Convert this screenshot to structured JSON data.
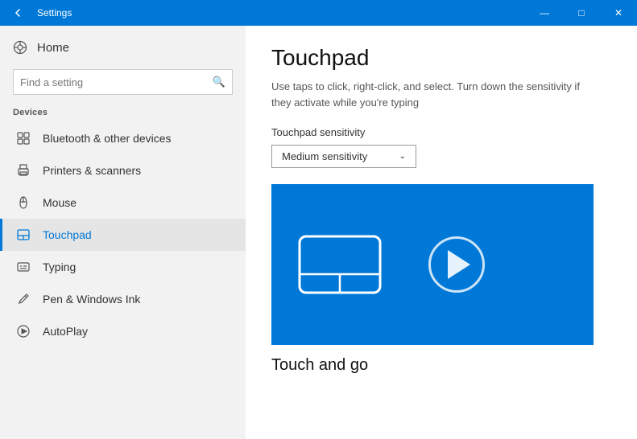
{
  "titlebar": {
    "title": "Settings",
    "back_label": "←",
    "minimize": "—",
    "maximize": "□",
    "close": "✕"
  },
  "sidebar": {
    "home_label": "Home",
    "search_placeholder": "Find a setting",
    "section_label": "Devices",
    "items": [
      {
        "id": "bluetooth",
        "label": "Bluetooth & other devices",
        "icon": "bluetooth"
      },
      {
        "id": "printers",
        "label": "Printers & scanners",
        "icon": "printer"
      },
      {
        "id": "mouse",
        "label": "Mouse",
        "icon": "mouse"
      },
      {
        "id": "touchpad",
        "label": "Touchpad",
        "icon": "touchpad",
        "active": true
      },
      {
        "id": "typing",
        "label": "Typing",
        "icon": "typing"
      },
      {
        "id": "pen",
        "label": "Pen & Windows Ink",
        "icon": "pen"
      },
      {
        "id": "autoplay",
        "label": "AutoPlay",
        "icon": "autoplay"
      }
    ]
  },
  "content": {
    "title": "Touchpad",
    "description": "Use taps to click, right-click, and select. Turn down the sensitivity if they activate while you're typing",
    "sensitivity_label": "Touchpad sensitivity",
    "sensitivity_value": "Medium sensitivity",
    "video_section_title": "Touch and go"
  }
}
